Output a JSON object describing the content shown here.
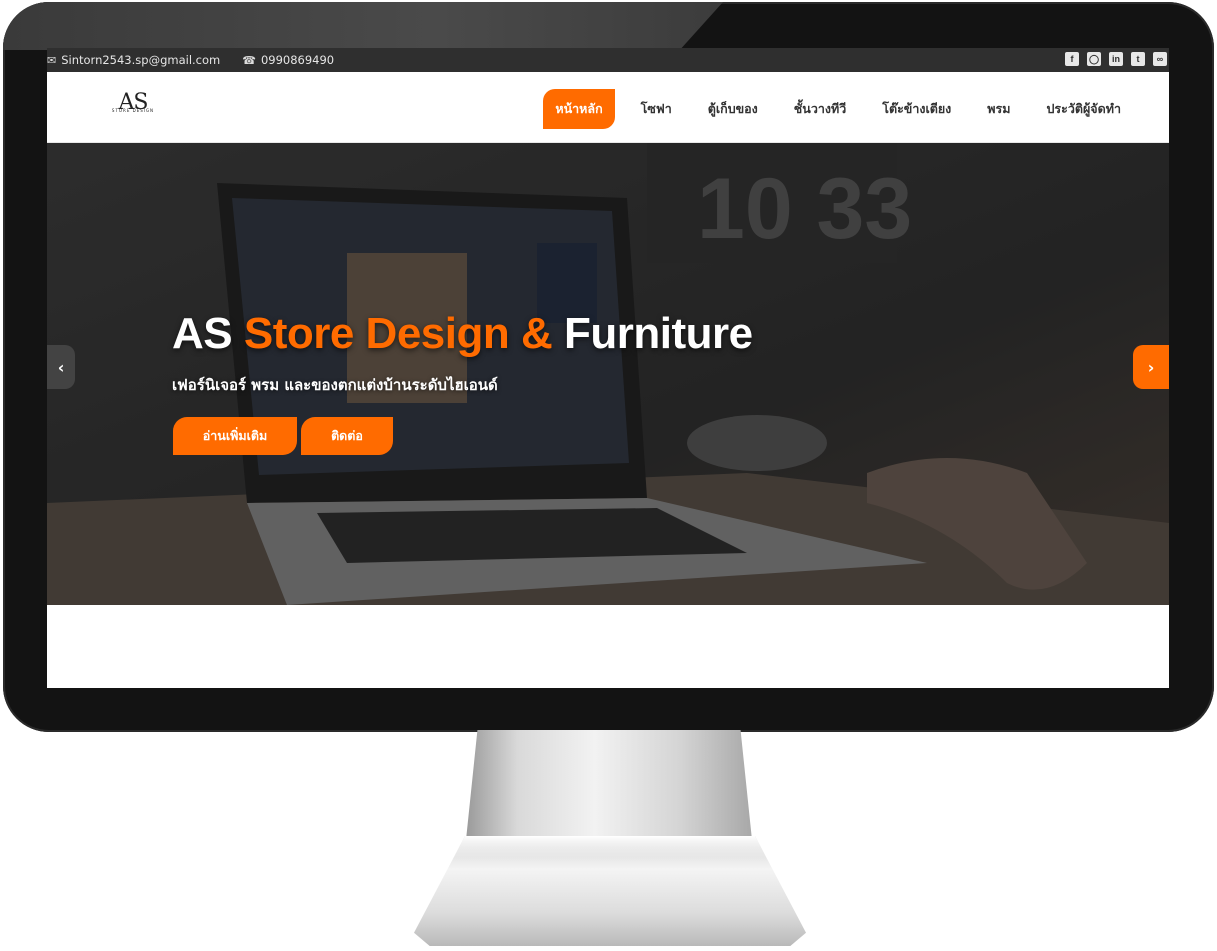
{
  "topbar": {
    "email": "Sintorn2543.sp@gmail.com",
    "email_icon": "envelope-icon",
    "phone": "0990869490",
    "phone_icon": "phone-icon",
    "social": [
      "facebook-icon",
      "instagram-icon",
      "linkedin-icon",
      "twitter-icon",
      "rss-icon"
    ]
  },
  "logo": {
    "mark": "AS",
    "sub": "STORE DESIGN"
  },
  "nav": {
    "items": [
      "หน้าหลัก",
      "โซฟา",
      "ตู้เก็บของ",
      "ชั้นวางทีวี",
      "โต๊ะข้างเตียง",
      "พรม",
      "ประวัติผู้จัดทำ"
    ],
    "active_index": 0
  },
  "hero": {
    "title_prefix": "AS",
    "title_accent": "Store Design &",
    "title_suffix": "Furniture",
    "subtitle": "เฟอร์นิเจอร์ พรม และของตกแต่งบ้านระดับไฮเอนด์",
    "read_more": "อ่านเพิ่มเติม",
    "contact": "ติดต่อ",
    "prev_icon": "chevron-left-icon",
    "next_icon": "chevron-right-icon"
  },
  "colors": {
    "accent": "#ff6b00",
    "topbar": "#2f2f2f",
    "bezel": "#131313"
  }
}
